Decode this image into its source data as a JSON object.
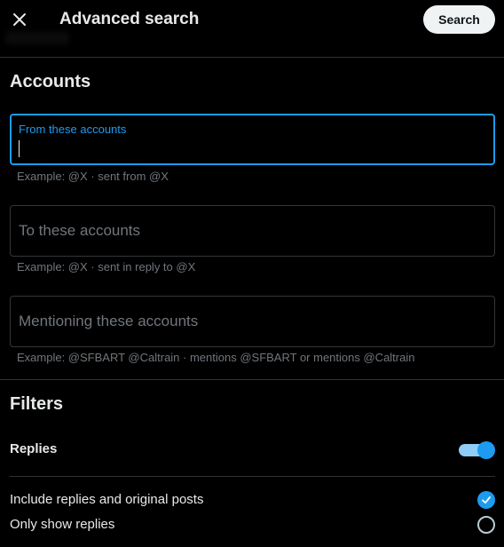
{
  "header": {
    "title": "Advanced search",
    "search_label": "Search"
  },
  "accounts": {
    "heading": "Accounts",
    "from": {
      "label": "From these accounts",
      "value": "",
      "hint": "Example: @X · sent from @X"
    },
    "to": {
      "placeholder": "To these accounts",
      "hint": "Example: @X · sent in reply to @X"
    },
    "mentioning": {
      "placeholder": "Mentioning these accounts",
      "hint": "Example: @SFBART @Caltrain · mentions @SFBART or mentions @Caltrain"
    }
  },
  "filters": {
    "heading": "Filters",
    "replies": {
      "label": "Replies",
      "enabled": true
    },
    "options": [
      {
        "label": "Include replies and original posts",
        "selected": true
      },
      {
        "label": "Only show replies",
        "selected": false
      }
    ]
  },
  "colors": {
    "accent": "#1d9bf0",
    "background": "#000000",
    "border": "#2f3336"
  },
  "icons": {
    "close": "close-icon",
    "check": "check-icon"
  }
}
